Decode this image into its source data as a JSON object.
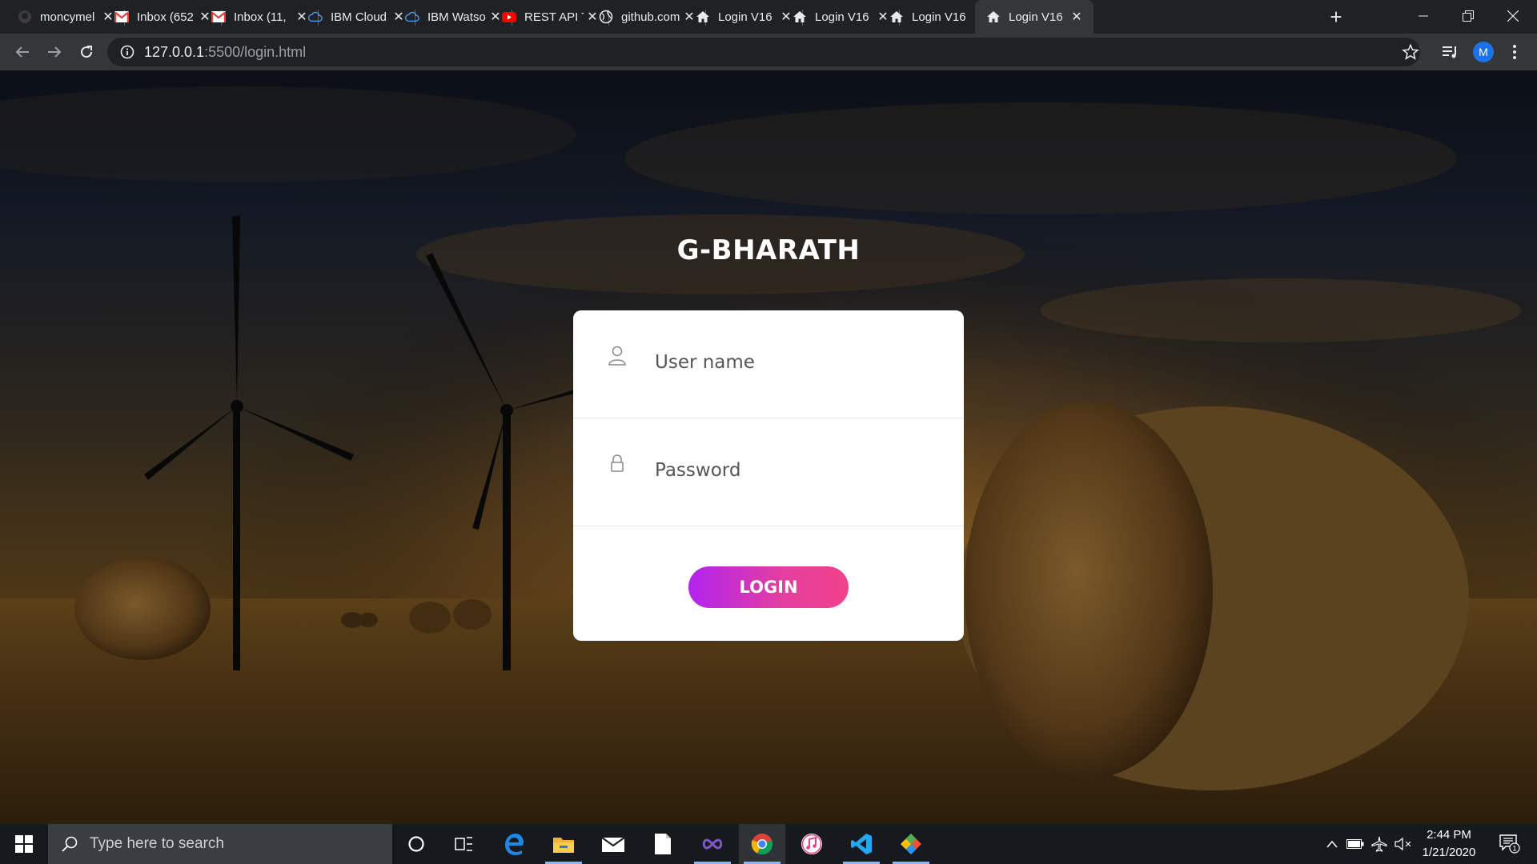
{
  "browser": {
    "tabs": [
      {
        "title": "moncymel",
        "icon": "github-icon"
      },
      {
        "title": "Inbox (652",
        "icon": "gmail-icon"
      },
      {
        "title": "Inbox (11,",
        "icon": "gmail-icon"
      },
      {
        "title": "IBM Cloud",
        "icon": "ibm-cloud-icon"
      },
      {
        "title": "IBM Watso",
        "icon": "ibm-cloud-icon"
      },
      {
        "title": "REST API T",
        "icon": "youtube-icon"
      },
      {
        "title": "github.com",
        "icon": "globe-icon"
      },
      {
        "title": "Login V16",
        "icon": "home-icon"
      },
      {
        "title": "Login V16",
        "icon": "home-icon"
      },
      {
        "title": "Login V16",
        "icon": "home-icon"
      },
      {
        "title": "Login V16",
        "icon": "home-icon",
        "active": true
      }
    ],
    "close_glyph": "✕",
    "new_tab_glyph": "+",
    "url_host": "127.0.0.1",
    "url_rest": ":5500/login.html",
    "profile_initial": "M"
  },
  "page": {
    "brand": "G-BHARATH",
    "username_placeholder": "User name",
    "password_placeholder": "Password",
    "login_label": "LOGIN"
  },
  "taskbar": {
    "search_placeholder": "Type here to search",
    "time": "2:44 PM",
    "date": "1/21/2020",
    "notification_count": "1"
  },
  "colors": {
    "tabstrip": "#202124",
    "toolbar": "#35363a",
    "button_gradient_start": "#b224ef",
    "button_gradient_end": "#f0428a"
  }
}
